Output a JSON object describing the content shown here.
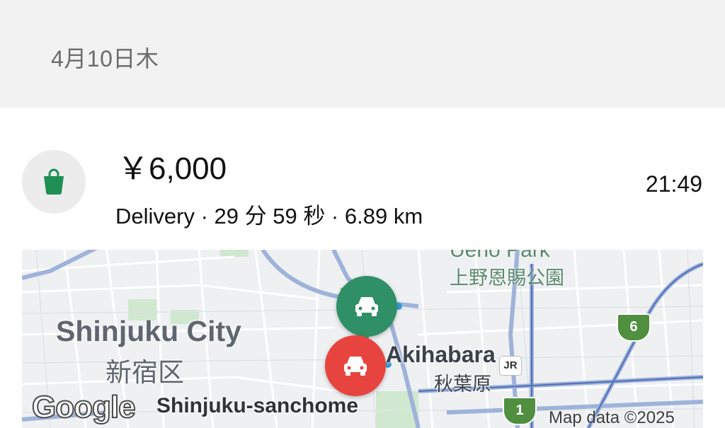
{
  "header": {
    "date": "4月10日木"
  },
  "trip": {
    "amount": "￥6,000",
    "time": "21:49",
    "details": "Delivery · 29 分 59 秒 · 6.89 km",
    "icon": "shopping-bag-icon"
  },
  "map": {
    "labels": {
      "city": "Shinjuku City",
      "city_jp": "新宿区",
      "park": "Ueno Park",
      "park_jp": "上野恩賜公園",
      "station": "Akihabara",
      "station_jp": "秋葉原",
      "area": "Shinjuku-sanchome",
      "attribution": "Map data ©2025",
      "google": "Google",
      "jr": "JR",
      "route_6": "6",
      "route_1": "1"
    },
    "markers": [
      {
        "name": "pickup",
        "icon": "car-icon",
        "color": "#2f8f67"
      },
      {
        "name": "dropoff",
        "icon": "car-icon",
        "color": "#e8443f"
      }
    ]
  },
  "colors": {
    "accent_green": "#1f8f55",
    "header_bg": "#f2f2f2",
    "marker_green": "#2f8f67",
    "marker_red": "#e8443f"
  }
}
